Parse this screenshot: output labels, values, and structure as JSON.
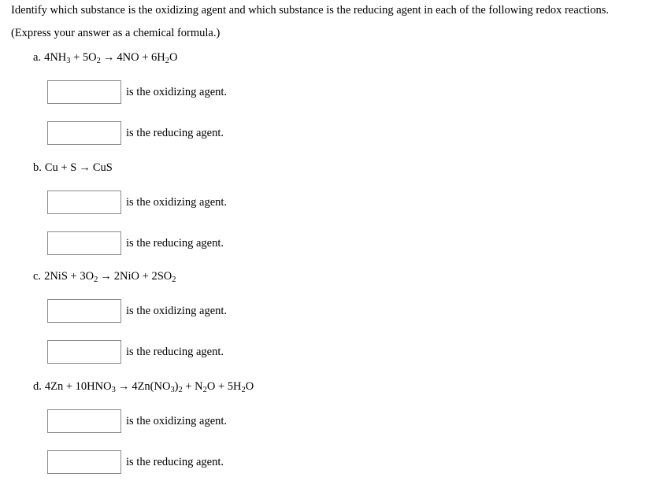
{
  "intro": {
    "line1": "Identify which substance is the oxidizing agent and which substance is the reducing agent in each of the following redox reactions.",
    "line2": "(Express your answer as a chemical formula.)"
  },
  "labels": {
    "oxidizing": "is the oxidizing agent.",
    "reducing": "is the reducing agent."
  },
  "arrow_glyph": "→",
  "sections": [
    {
      "letter": "a.",
      "equation_plain": "4NH3 + 5O2 → 4NO + 6H2O",
      "reactant1": "4NH",
      "reactant1_sub": "3",
      "reactant2": "5O",
      "reactant2_sub": "2",
      "product1": "4NO",
      "product2a": "6H",
      "product2_sub": "2",
      "product2b": "O",
      "oxidizing_value": "",
      "reducing_value": ""
    },
    {
      "letter": "b.",
      "equation_plain": "Cu + S → CuS",
      "reactant1": "Cu",
      "reactant1_sub": "",
      "reactant2": "S",
      "reactant2_sub": "",
      "product1": "CuS",
      "product2a": "",
      "product2_sub": "",
      "product2b": "",
      "oxidizing_value": "",
      "reducing_value": ""
    },
    {
      "letter": "c.",
      "equation_plain": "2NiS + 3O2 → 2NiO + 2SO2",
      "reactant1": "2NiS",
      "reactant1_sub": "",
      "reactant2": "3O",
      "reactant2_sub": "2",
      "product1": "2NiO",
      "product2a": "2SO",
      "product2_sub": "2",
      "product2b": "",
      "oxidizing_value": "",
      "reducing_value": ""
    },
    {
      "letter": "d.",
      "equation_plain": "4Zn + 10HNO3 → 4Zn(NO3)2 + N2O + 5H2O",
      "reactant1": "4Zn",
      "reactant1_sub": "",
      "reactant2": "10HNO",
      "reactant2_sub": "3",
      "product1": "4Zn(NO",
      "product1_sub": "3",
      "product1b": ")",
      "product1_sub2": "2",
      "product2a": "N",
      "product2_sub": "2",
      "product2b": "O",
      "product3a": "5H",
      "product3_sub": "2",
      "product3b": "O",
      "oxidizing_value": "",
      "reducing_value": ""
    }
  ]
}
